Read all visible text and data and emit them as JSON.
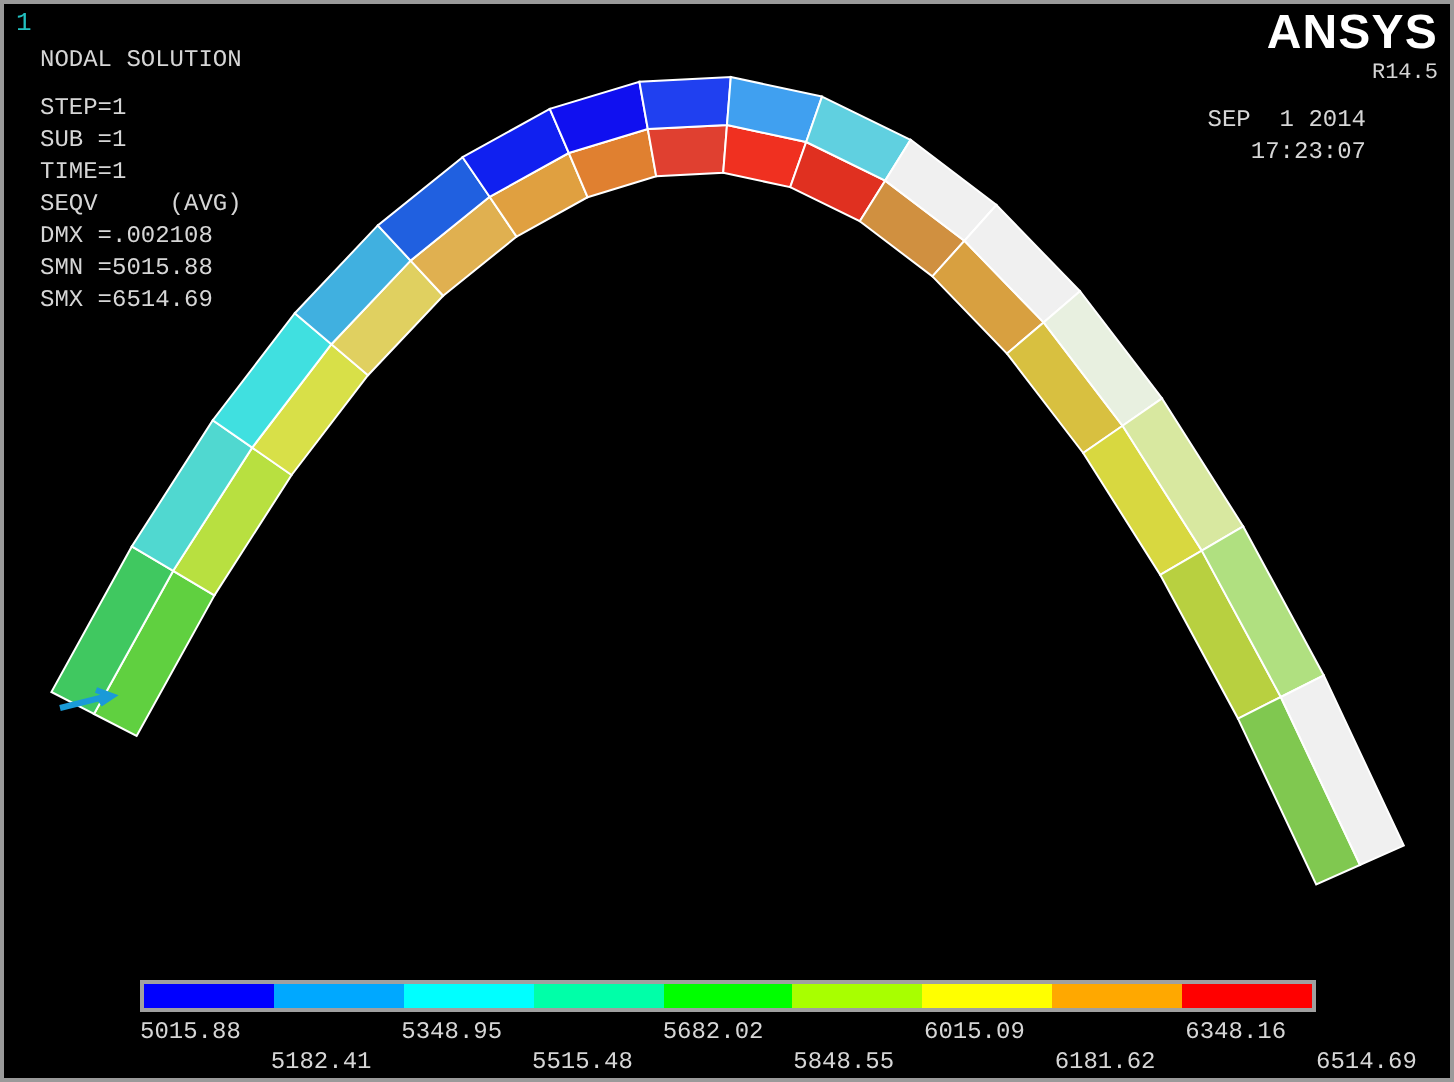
{
  "window_number": "1",
  "info": {
    "title": "NODAL SOLUTION",
    "lines": [
      "STEP=1",
      "SUB =1",
      "TIME=1",
      "SEQV     (AVG)",
      "DMX =.002108",
      "SMN =5015.88",
      "SMX =6514.69"
    ]
  },
  "brand": {
    "name": "ANSYS",
    "version": "R14.5",
    "date": "SEP  1 2014",
    "time": "17:23:07"
  },
  "legend": {
    "bands": [
      {
        "color": "#0000ff"
      },
      {
        "color": "#00a8ff"
      },
      {
        "color": "#00ffff"
      },
      {
        "color": "#00ffa8"
      },
      {
        "color": "#00ff00"
      },
      {
        "color": "#a8ff00"
      },
      {
        "color": "#ffff00"
      },
      {
        "color": "#ffa800"
      },
      {
        "color": "#ff0000"
      }
    ],
    "labels": [
      "5015.88",
      "5182.41",
      "5348.95",
      "5515.48",
      "5682.02",
      "5848.55",
      "6015.09",
      "6181.62",
      "6348.16",
      "6514.69"
    ]
  }
}
